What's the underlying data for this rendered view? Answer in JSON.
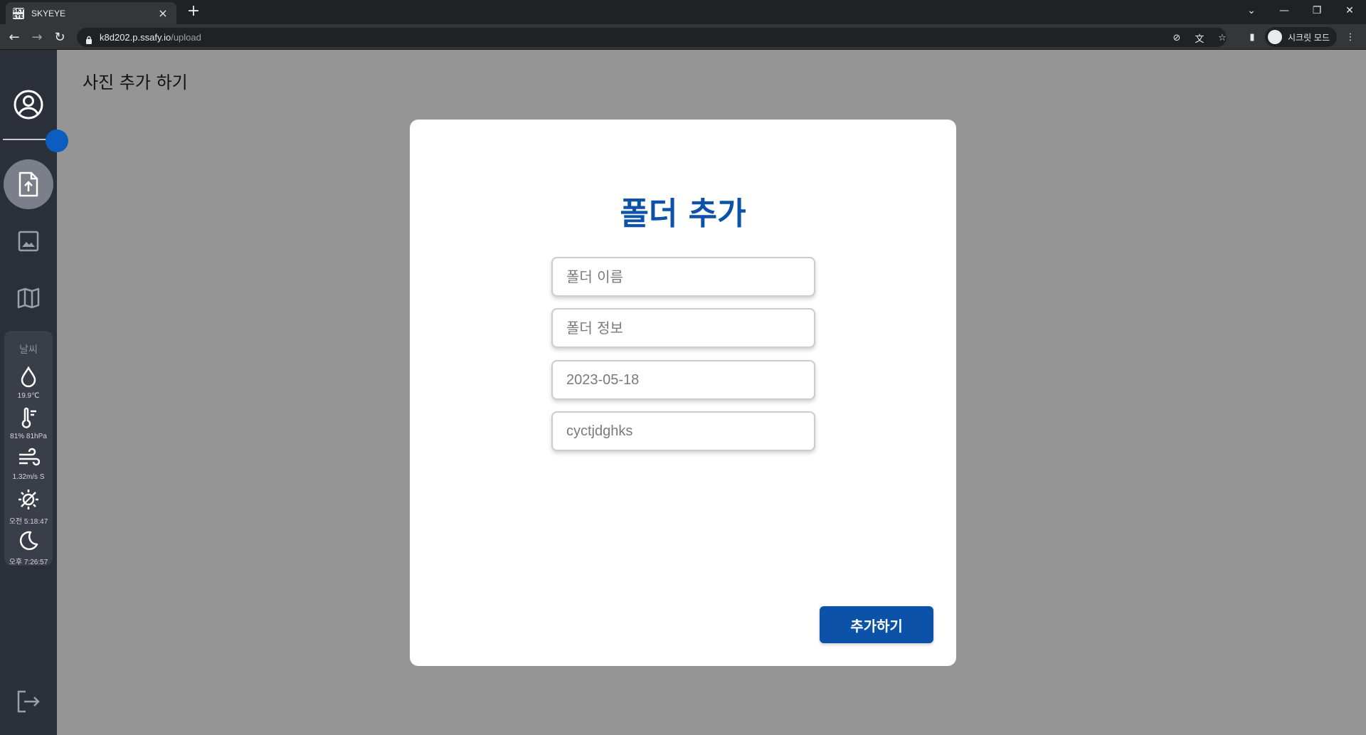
{
  "browser": {
    "tab_title": "SKYEYE",
    "favicon_text": "SKY EYE",
    "url_host": "k8d202.p.ssafy.io",
    "url_path": "/upload",
    "incognito_label": "시크릿 모드"
  },
  "sidebar": {
    "profile_icon": "user-circle-icon",
    "nav": [
      {
        "icon": "upload-file-icon",
        "active": true
      },
      {
        "icon": "image-icon",
        "active": false
      },
      {
        "icon": "map-icon",
        "active": false
      }
    ],
    "weather": {
      "title": "날씨",
      "items": [
        {
          "icon": "droplet-icon",
          "label": "19.9℃"
        },
        {
          "icon": "thermometer-icon",
          "label": "81% 81hPa"
        },
        {
          "icon": "wind-icon",
          "label": "1.32m/s S"
        },
        {
          "icon": "sunrise-icon",
          "label": "오전 5:18:47"
        },
        {
          "icon": "moon-icon",
          "label": "오후 7:26:57"
        }
      ]
    },
    "logout_icon": "logout-icon"
  },
  "main": {
    "page_title": "사진 추가 하기"
  },
  "modal": {
    "title": "폴더 추가",
    "fields": {
      "folder_name_placeholder": "폴더 이름",
      "folder_info_placeholder": "폴더 정보",
      "date_value": "2023-05-18",
      "extra_value": "cyctjdghks"
    },
    "submit_label": "추가하기"
  },
  "colors": {
    "accent": "#0b52a8",
    "sidebar_bg": "#2b2f3a",
    "overlay_bg": "#959595"
  }
}
